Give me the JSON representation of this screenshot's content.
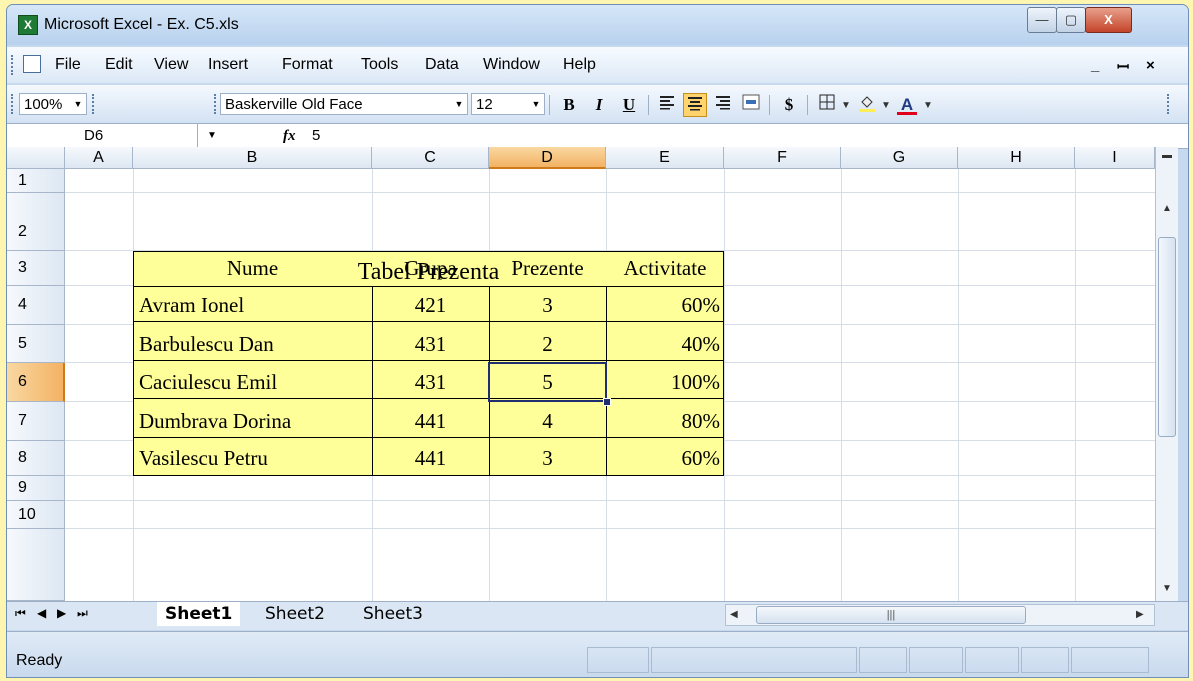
{
  "window": {
    "title": "Microsoft Excel - Ex. C5.xls",
    "app_icon": "X",
    "controls": {
      "minimize": "—",
      "maximize": "▢",
      "close": "X"
    }
  },
  "menu": {
    "items": [
      {
        "label": "File"
      },
      {
        "label": "Edit"
      },
      {
        "label": "View"
      },
      {
        "label": "Insert"
      },
      {
        "label": "Format"
      },
      {
        "label": "Tools"
      },
      {
        "label": "Data"
      },
      {
        "label": "Window"
      },
      {
        "label": "Help"
      }
    ],
    "doc_minimize": "_",
    "doc_restore": "ꟷ",
    "doc_close": "×"
  },
  "toolbar": {
    "zoom": "100%",
    "font_name": "Baskerville Old Face",
    "font_size": "12",
    "bold": "B",
    "italic": "I",
    "underline": "U",
    "currency": "$",
    "font_color_letter": "A",
    "accent_color": "#ffd46e"
  },
  "formula_bar": {
    "name_box": "D6",
    "fx": "fx",
    "value": "5"
  },
  "sheet": {
    "columns": [
      "A",
      "B",
      "C",
      "D",
      "E",
      "F",
      "G",
      "H",
      "I"
    ],
    "rows": [
      "1",
      "2",
      "3",
      "4",
      "5",
      "6",
      "7",
      "8",
      "9",
      "10"
    ],
    "selected_column": "D",
    "selected_row": "6",
    "table": {
      "title": "Tabel Prezenta",
      "headers": [
        "Nume",
        "Grupa",
        "Prezente",
        "Activitate"
      ],
      "rows": [
        [
          "Avram Ionel",
          "421",
          "3",
          "60%"
        ],
        [
          "Barbulescu Dan",
          "431",
          "2",
          "40%"
        ],
        [
          "Caciulescu Emil",
          "431",
          "5",
          "100%"
        ],
        [
          "Dumbrava Dorina",
          "441",
          "4",
          "80%"
        ],
        [
          "Vasilescu Petru",
          "441",
          "3",
          "60%"
        ]
      ],
      "fill_color": "#ffff99"
    }
  },
  "tabs": {
    "items": [
      "Sheet1",
      "Sheet2",
      "Sheet3"
    ],
    "active": "Sheet1"
  },
  "status": {
    "text": "Ready"
  }
}
